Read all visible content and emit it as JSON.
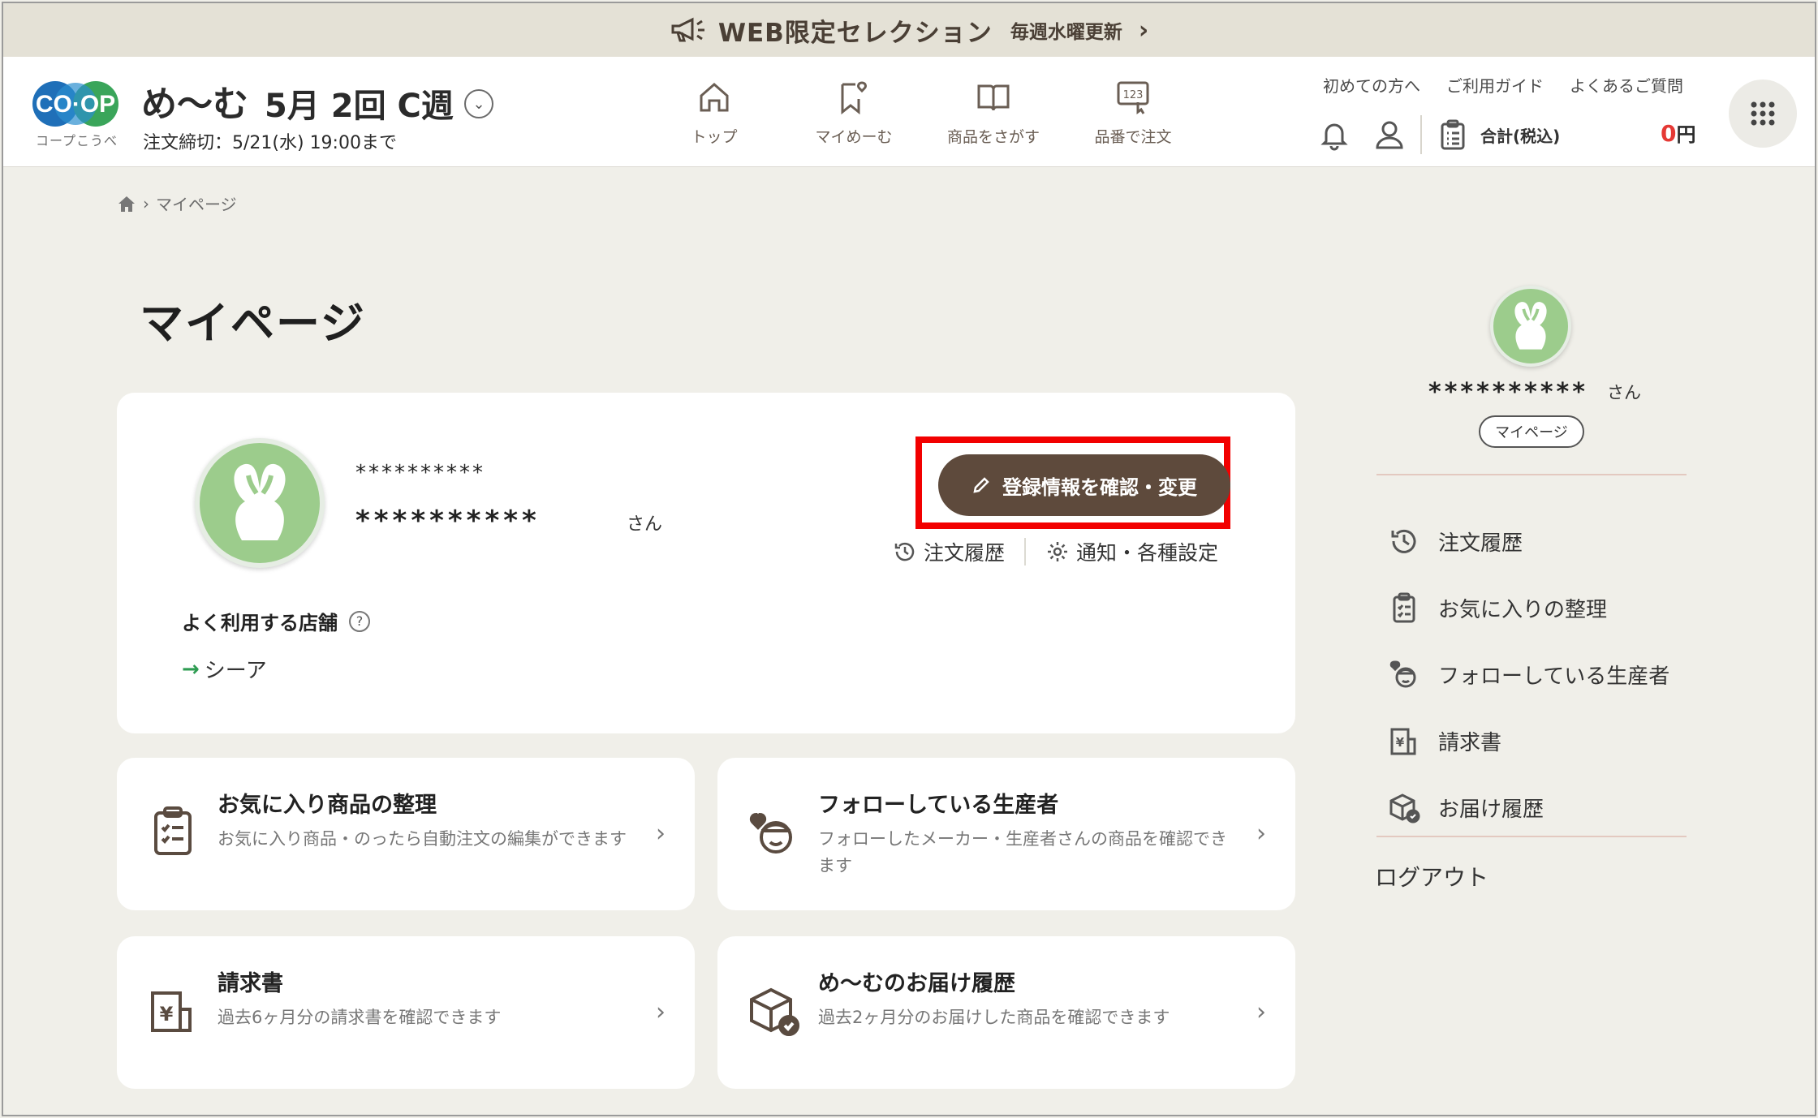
{
  "banner": {
    "text": "WEB限定セレクション",
    "sub": "毎週水曜更新",
    "chevron": "›",
    "icon": "megaphone-icon"
  },
  "header": {
    "logo_text": "CO-OP",
    "logo_sub": "コープこうべ",
    "brand": "め〜む",
    "week": "5月 2回 C週",
    "deadline": "注文締切：5/21(水) 19:00まで",
    "nav": [
      {
        "label": "トップ",
        "icon": "home-icon"
      },
      {
        "label": "マイめーむ",
        "icon": "my-meemu-icon"
      },
      {
        "label": "商品をさがす",
        "icon": "book-icon"
      },
      {
        "label": "品番で注文",
        "icon": "number-order-icon"
      }
    ],
    "toplinks": [
      "初めての方へ",
      "ご利用ガイド",
      "よくあるご質問"
    ],
    "cart_label": "合計(税込)",
    "cart_total": "0",
    "cart_unit": "円"
  },
  "breadcrumb": {
    "current": "マイページ"
  },
  "page_title": "マイページ",
  "profile": {
    "name_kana": "**********",
    "name": "**********",
    "honorific": "さん",
    "edit_button": "登録情報を確認・変更",
    "links": [
      "注文履歴",
      "通知・各種設定"
    ],
    "store_label": "よく利用する店舗",
    "store_help": "?",
    "store_name": "シーア"
  },
  "tiles": [
    {
      "title": "お気に入り商品の整理",
      "desc": "お気に入り商品・のったら自動注文の編集ができます",
      "icon": "clipboard-list-icon"
    },
    {
      "title": "フォローしている生産者",
      "desc": "フォローしたメーカー・生産者さんの商品を確認できます",
      "icon": "producer-heart-icon"
    },
    {
      "title": "請求書",
      "desc": "過去6ヶ月分の請求書を確認できます",
      "icon": "invoice-yen-icon"
    },
    {
      "title": "め〜むのお届け履歴",
      "desc": "過去2ヶ月分のお届けした商品を確認できます",
      "icon": "delivery-box-icon"
    }
  ],
  "sidebar": {
    "name": "**********",
    "honorific": "さん",
    "mypage_label": "マイページ",
    "items": [
      {
        "label": "注文履歴",
        "icon": "history-icon"
      },
      {
        "label": "お気に入りの整理",
        "icon": "clipboard-list-icon"
      },
      {
        "label": "フォローしている生産者",
        "icon": "producer-heart-icon"
      },
      {
        "label": "請求書",
        "icon": "invoice-yen-icon"
      },
      {
        "label": "お届け履歴",
        "icon": "delivery-box-icon"
      }
    ],
    "logout": "ログアウト"
  },
  "colors": {
    "accent_brown": "#5e4a3c",
    "highlight_red": "#f20000",
    "cart_total_red": "#e53935",
    "avatar_green": "#9ccc8c",
    "background": "#f0efe9"
  }
}
